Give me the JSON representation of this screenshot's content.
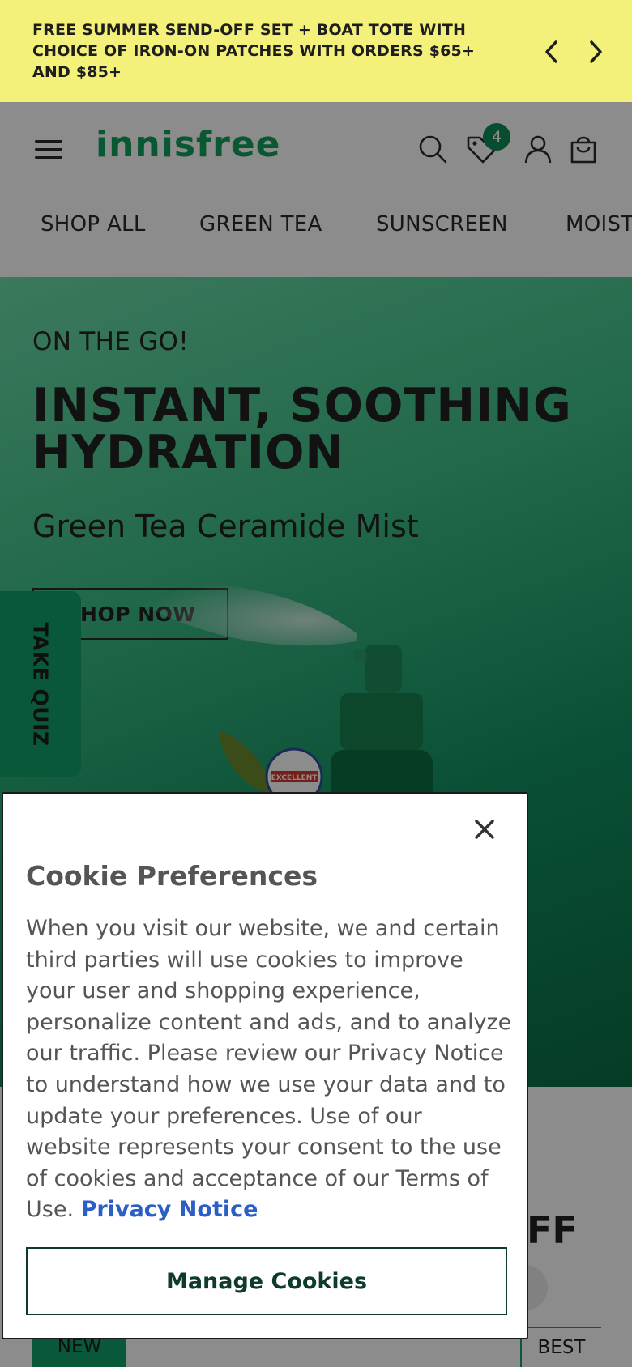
{
  "promo": {
    "text": "FREE SUMMER SEND-OFF SET + BOAT TOTE WITH CHOICE OF IRON-ON PATCHES WITH ORDERS $65+ AND $85+",
    "prev_icon": "chevron-left-icon",
    "next_icon": "chevron-right-icon",
    "background": "#f3f17a"
  },
  "header": {
    "logo": "innisfree",
    "menu_icon": "hamburger-menu-icon",
    "search_icon": "search-icon",
    "wishlist_icon": "wishlist-tag-icon",
    "wishlist_count": "4",
    "account_icon": "user-icon",
    "cart_icon": "shopping-bag-icon",
    "brand_color": "#11a05a"
  },
  "nav": {
    "items": [
      "SHOP ALL",
      "GREEN TEA",
      "SUNSCREEN",
      "MOIST"
    ]
  },
  "hero": {
    "eyebrow": "ON THE GO!",
    "title": "INSTANT, SOOTHING HYDRATION",
    "subtitle": "Green Tea Ceramide Mist",
    "button": "SHOP NOW",
    "seal_text": "EXCELLENT"
  },
  "quiz": {
    "label": "TAKE QUIZ"
  },
  "lower": {
    "heading_fragment": "FF",
    "tag_new": "NEW",
    "tag_best": "BEST"
  },
  "cookie": {
    "title": "Cookie Preferences",
    "body": "When you visit our website, we and certain third parties will use cookies to improve your user and shopping experience, personalize content and ads, and to analyze our traffic. Please review our Privacy Notice to understand how we use your data and to update your preferences. Use of our website represents your consent to the use of cookies and acceptance of our Terms of Use.",
    "link": "Privacy Notice",
    "button": "Manage Cookies",
    "close_icon": "close-icon",
    "link_color": "#2c5ec8"
  }
}
